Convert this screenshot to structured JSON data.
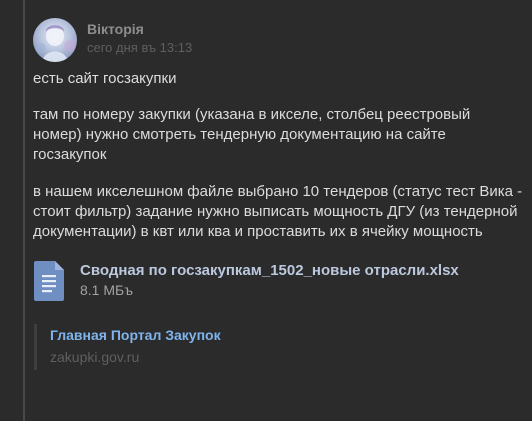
{
  "message": {
    "author": "Вікторія",
    "timestamp": "сего дня въ 13:13",
    "paragraphs": [
      "есть сайт госзакупки",
      "там по номеру закупки (указана в икселе, столбец реестровый номер) нужно смотреть тендерную документацию на сайте госзакупок",
      "в нашем икселешном файле выбрано 10 тендеров (статус тест Вика - стоит фильтр) задание нужно выписать мощность ДГУ (из тендерной документации) в квт или ква и проставить их в ячейку мощность"
    ],
    "attachment": {
      "icon": "document-icon",
      "name": "Сводная по госзакупкам_1502_новые отрасли.xlsx",
      "size": "8.1 МБъ"
    },
    "embed": {
      "title": "Главная Портал Закупок",
      "url": "zakupki.gov.ru"
    }
  },
  "colors": {
    "background": "#2b2b2b",
    "text": "#dcdcdc",
    "author": "#8e8e8e",
    "muted": "#5f5f5f",
    "link": "#7fb4ec",
    "file_icon": "#6f8ec2"
  }
}
